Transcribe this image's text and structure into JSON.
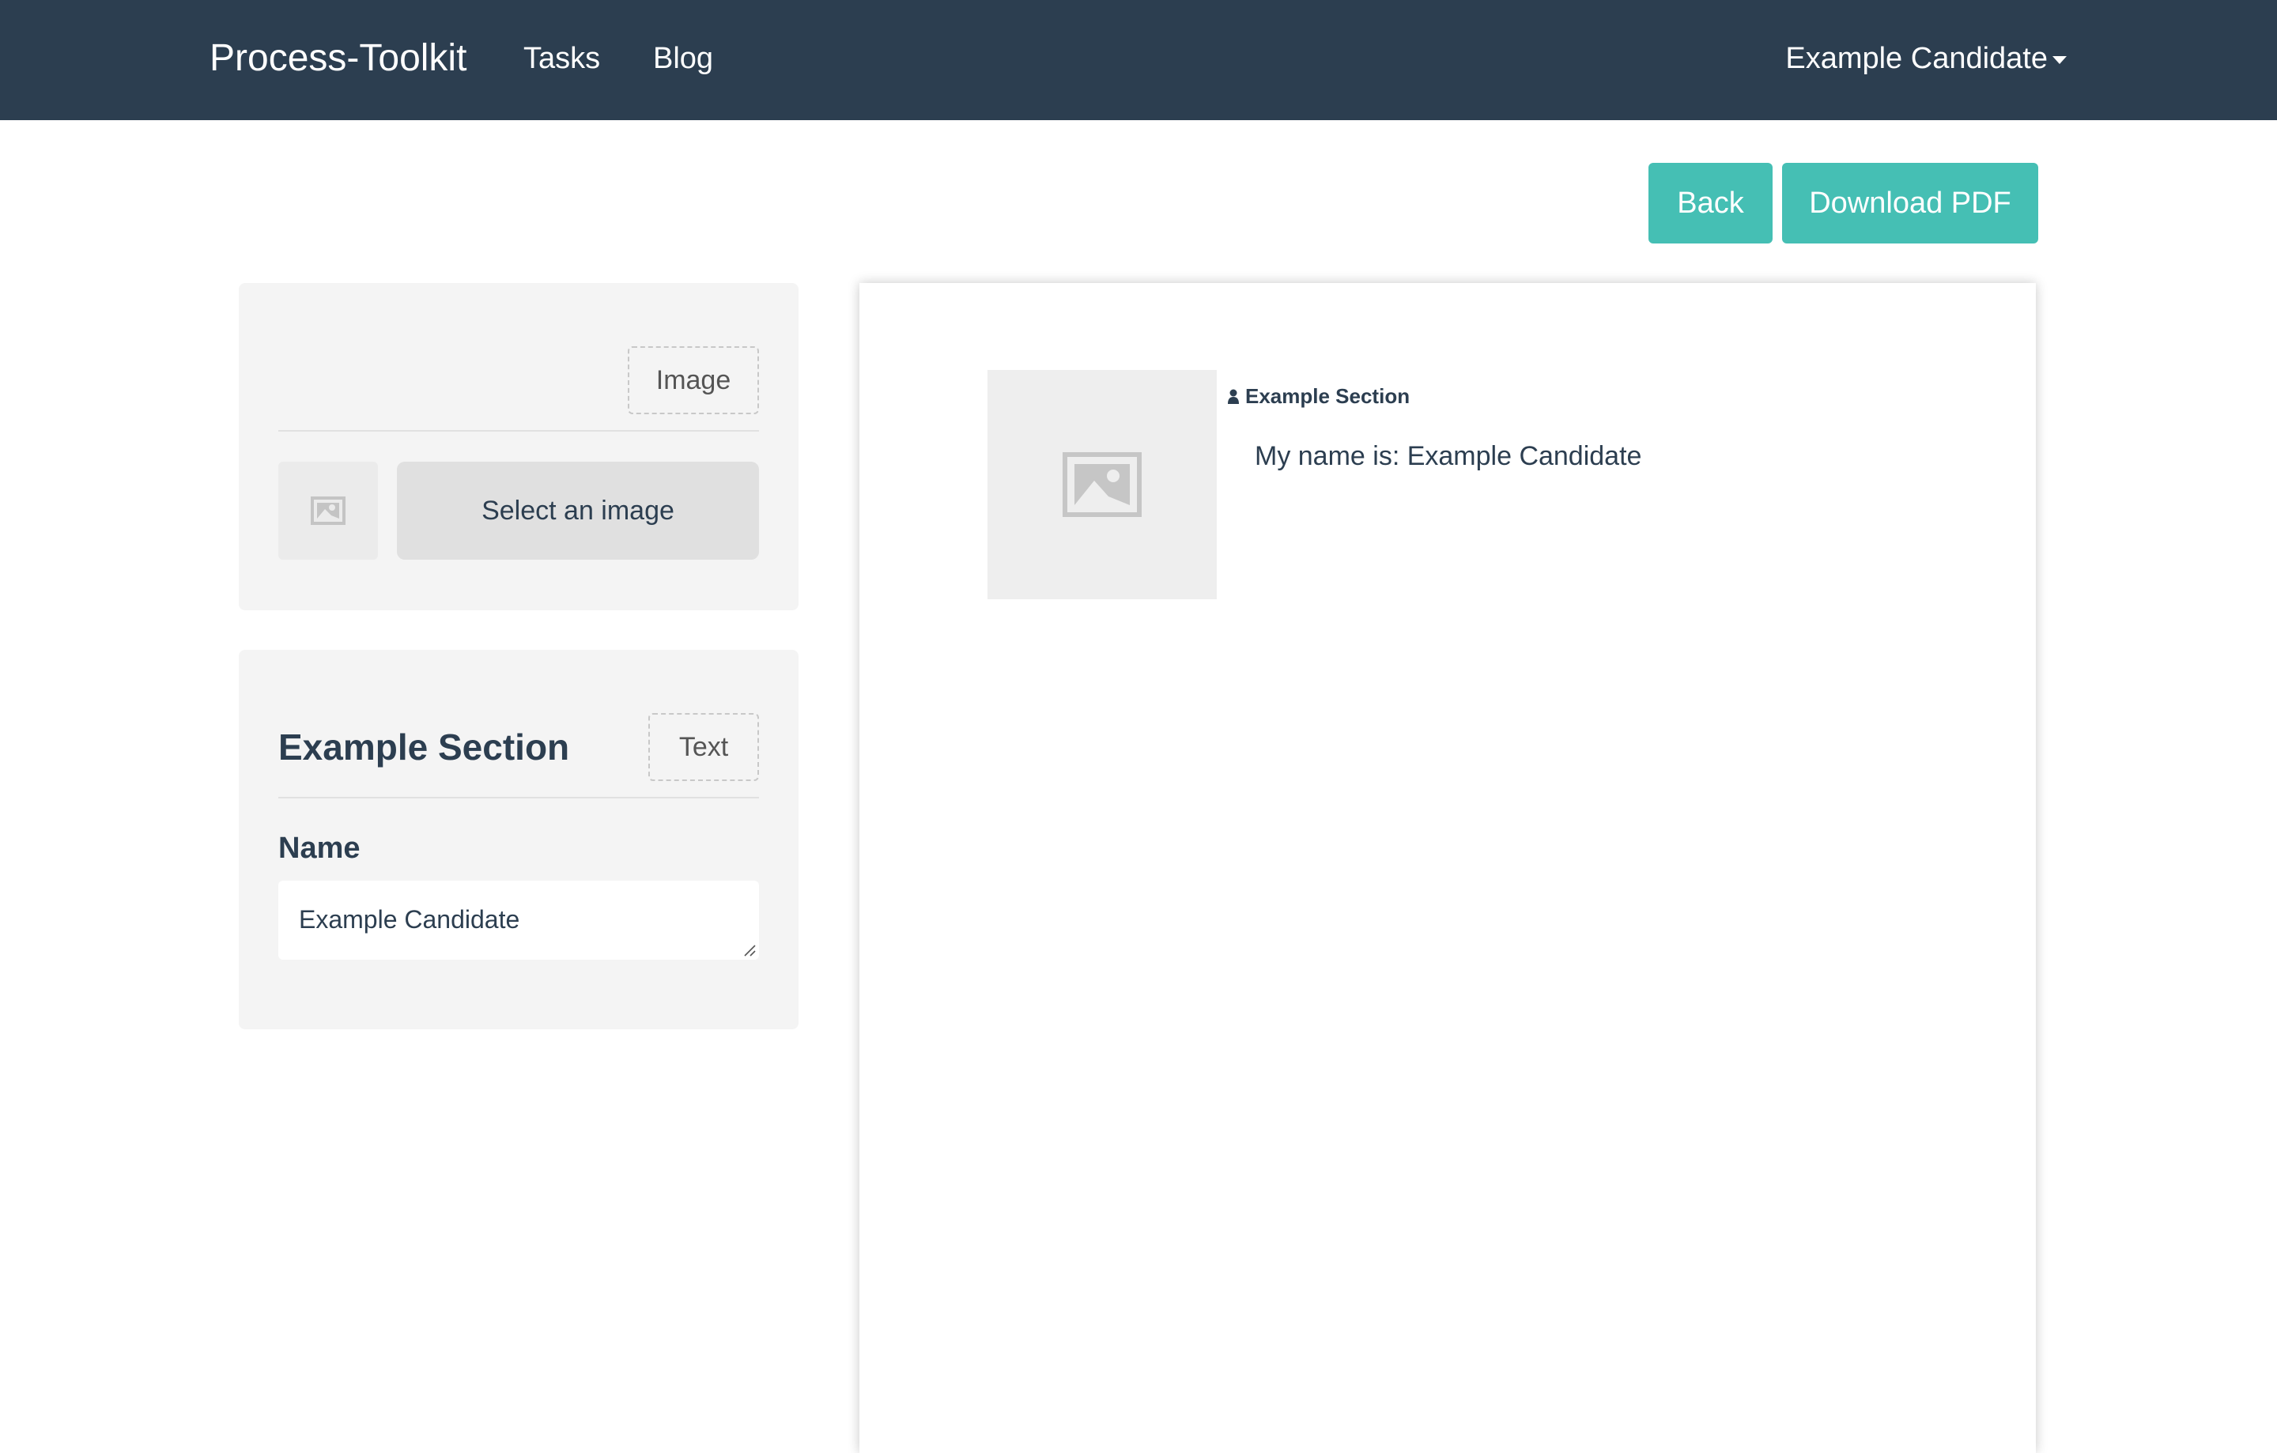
{
  "navbar": {
    "brand": "Process-Toolkit",
    "links": [
      {
        "label": "Tasks"
      },
      {
        "label": "Blog"
      }
    ],
    "user": {
      "name": "Example Candidate",
      "icon": "caret-down-icon"
    }
  },
  "toolbar": {
    "back_label": "Back",
    "download_label": "Download PDF",
    "accent_color": "#45bfb4"
  },
  "editor": {
    "image_card": {
      "type_label": "Image",
      "thumbnail_icon": "image-placeholder-icon",
      "select_label": "Select an image"
    },
    "text_card": {
      "title": "Example Section",
      "type_label": "Text",
      "field_label": "Name",
      "field_value": "Example Candidate"
    }
  },
  "preview": {
    "photo_icon": "image-placeholder-icon",
    "section_icon": "user-icon",
    "section_heading": "Example Section",
    "line_prefix": "My name is: ",
    "line_text": "My name is: Example Candidate"
  },
  "colors": {
    "navbar_bg": "#2c3e50",
    "text": "#2c3e50",
    "card_bg": "#f4f4f4"
  }
}
